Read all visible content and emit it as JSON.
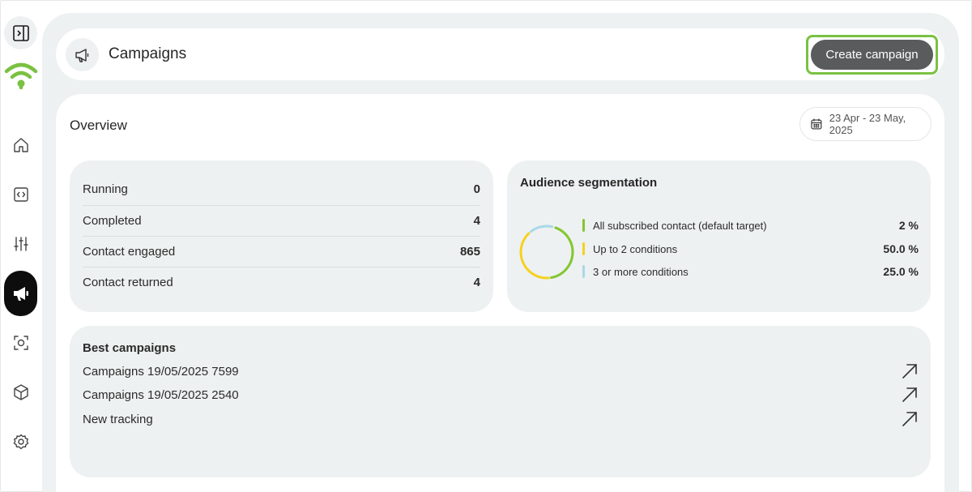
{
  "header": {
    "title": "Campaigns",
    "create_label": "Create campaign"
  },
  "overview": {
    "title": "Overview",
    "date_range": "23 Apr - 23 May, 2025"
  },
  "stats": [
    {
      "label": "Running",
      "value": "0"
    },
    {
      "label": "Completed",
      "value": "4"
    },
    {
      "label": "Contact engaged",
      "value": "865"
    },
    {
      "label": "Contact returned",
      "value": "4"
    }
  ],
  "audience": {
    "title": "Audience segmentation",
    "segments": [
      {
        "label": "All subscribed contact (default target)",
        "value": "2 %",
        "percent": 2,
        "color": "#84c730"
      },
      {
        "label": "Up to 2 conditions",
        "value": "50.0 %",
        "percent": 50,
        "color": "#f4d21f"
      },
      {
        "label": "3 or more conditions",
        "value": "25.0 %",
        "percent": 25,
        "color": "#a9d8e8"
      }
    ]
  },
  "best": {
    "title": "Best campaigns",
    "items": [
      {
        "label": "Campaigns 19/05/2025 7599"
      },
      {
        "label": "Campaigns 19/05/2025 2540"
      },
      {
        "label": "New tracking"
      }
    ]
  },
  "colors": {
    "accent": "#7ac142",
    "dark": "#0d0d0d",
    "button": "#5a5b5d"
  },
  "icons": [
    "sidebar-toggle-icon",
    "wifi-logo-icon",
    "home-icon",
    "code-icon",
    "sliders-icon",
    "megaphone-icon",
    "scan-icon",
    "cube-icon",
    "gear-icon",
    "calendar-icon",
    "arrow-up-right-icon"
  ]
}
